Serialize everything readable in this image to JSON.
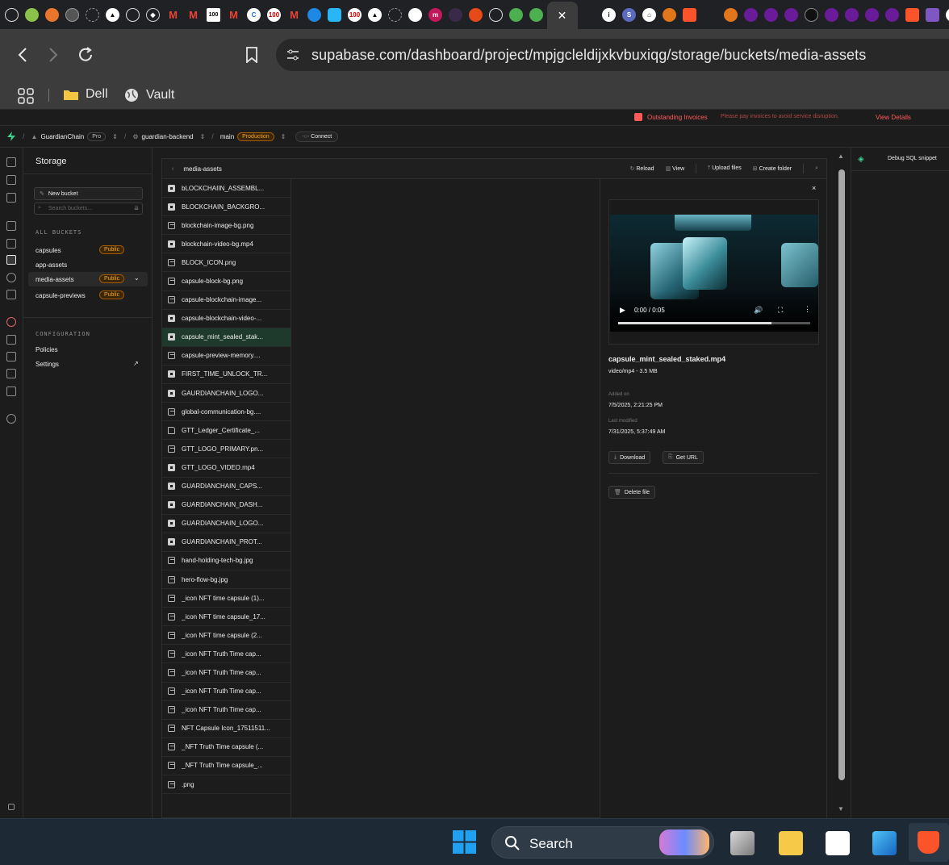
{
  "browser": {
    "url": "supabase.com/dashboard/project/mpjgcleldijxkvbuxiqg/storage/buckets/media-assets",
    "bookmarks": [
      {
        "label": "Dell",
        "icon": "folder-icon"
      },
      {
        "label": "Vault",
        "icon": "globe-icon"
      }
    ],
    "tab_close": "✕"
  },
  "banner": {
    "title": "Outstanding Invoices",
    "message": "Please pay invoices to avoid service disruption.",
    "link": "View Details"
  },
  "topnav": {
    "org": "GuardianChain",
    "org_plan": "Pro",
    "project": "guardian-backend",
    "branch": "main",
    "branch_env": "Production",
    "connect": "Connect"
  },
  "storage": {
    "title": "Storage",
    "new_bucket": "New bucket",
    "search_placeholder": "Search buckets...",
    "all_buckets_heading": "ALL BUCKETS",
    "buckets": [
      {
        "name": "capsules",
        "badge": "Public"
      },
      {
        "name": "app-assets",
        "badge": ""
      },
      {
        "name": "media-assets",
        "badge": "Public"
      },
      {
        "name": "capsule-previews",
        "badge": "Public"
      }
    ],
    "config_heading": "CONFIGURATION",
    "config_items": [
      "Policies",
      "Settings"
    ]
  },
  "explorer": {
    "breadcrumb": "media-assets",
    "actions": {
      "reload": "Reload",
      "view": "View",
      "upload": "Upload files",
      "create_folder": "Create folder"
    },
    "files": [
      {
        "name": "bLOCKCHAIIN_ASSEMBL...",
        "type": "vid"
      },
      {
        "name": "BLOCKCHAIN_BACKGRO...",
        "type": "vid"
      },
      {
        "name": "blockchain-image-bg.png",
        "type": "img"
      },
      {
        "name": "blockchain-video-bg.mp4",
        "type": "vid"
      },
      {
        "name": "BLOCK_ICON.png",
        "type": "img"
      },
      {
        "name": "capsule-block-bg.png",
        "type": "img"
      },
      {
        "name": "capsule-blockchain-image...",
        "type": "img"
      },
      {
        "name": "capsule-blockchain-video-...",
        "type": "vid"
      },
      {
        "name": "capsule_mint_sealed_stak...",
        "type": "vid",
        "selected": true
      },
      {
        "name": "capsule-preview-memory....",
        "type": "img"
      },
      {
        "name": "FIRST_TIME_UNLOCK_TR...",
        "type": "vid"
      },
      {
        "name": "GAURDIANCHAIN_LOGO...",
        "type": "vid"
      },
      {
        "name": "global-communication-bg....",
        "type": "img"
      },
      {
        "name": "GTT_Ledger_Certificate_...",
        "type": "doc"
      },
      {
        "name": "GTT_LOGO_PRIMARY.pn...",
        "type": "img"
      },
      {
        "name": "GTT_LOGO_VIDEO.mp4",
        "type": "vid"
      },
      {
        "name": "GUARDIANCHAIN_CAPS...",
        "type": "vid"
      },
      {
        "name": "GUARDIANCHAIN_DASH...",
        "type": "vid"
      },
      {
        "name": "GUARDIANCHAIN_LOGO...",
        "type": "vid"
      },
      {
        "name": "GUARDIANCHAIN_PROT...",
        "type": "vid"
      },
      {
        "name": "hand-holding-tech-bg.jpg",
        "type": "img"
      },
      {
        "name": "hero-flow-bg.jpg",
        "type": "img"
      },
      {
        "name": "_icon NFT time capsule (1)...",
        "type": "img"
      },
      {
        "name": "_icon NFT time capsule_17...",
        "type": "img"
      },
      {
        "name": "_icon NFT time capsule (2...",
        "type": "img"
      },
      {
        "name": "_icon NFT Truth Time cap...",
        "type": "img"
      },
      {
        "name": "_icon NFT Truth Time cap...",
        "type": "img"
      },
      {
        "name": "_icon NFT Truth Time cap...",
        "type": "img"
      },
      {
        "name": "_icon NFT Truth Time cap...",
        "type": "img"
      },
      {
        "name": "NFT Capsule Icon_17511511...",
        "type": "img"
      },
      {
        "name": "_NFT Truth Time capsule (...",
        "type": "img"
      },
      {
        "name": "_NFT Truth Time capsule_...",
        "type": "img"
      },
      {
        "name": ".png",
        "type": "img"
      }
    ]
  },
  "preview": {
    "time": "0:00 / 0:05",
    "progress": 0.8,
    "filename": "capsule_mint_sealed_staked.mp4",
    "meta": "video/mp4 - 3.5 MB",
    "added_label": "Added on",
    "added_value": "7/5/2025, 2:21:25 PM",
    "modified_label": "Last modified",
    "modified_value": "7/31/2025, 5:37:49 AM",
    "download": "Download",
    "get_url": "Get URL",
    "delete": "Delete file"
  },
  "rightpanel": {
    "title": "Debug SQL snippet"
  },
  "taskbar": {
    "search": "Search"
  },
  "colors": {
    "accent": "#3ecf8e",
    "warning": "#ff5a5a",
    "badge": "#f5a623"
  }
}
